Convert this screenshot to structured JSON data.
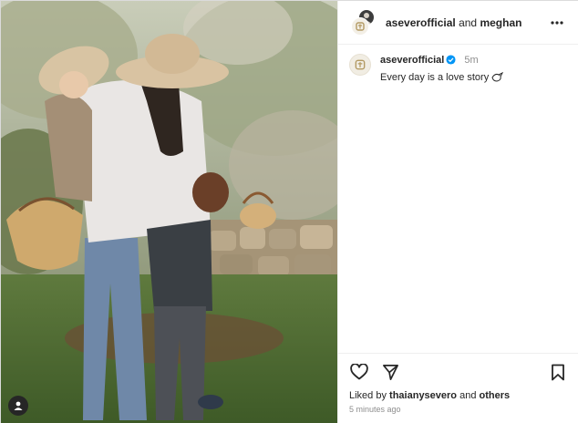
{
  "post_header": {
    "primary_user": "aseverofficial",
    "conjunction": "and",
    "secondary_user": "meghan",
    "more_icon": "more-horizontal-icon"
  },
  "caption": {
    "username": "aseverofficial",
    "verified_icon": "verified-badge-icon",
    "time_ago": "5m",
    "text": "Every day is a love story",
    "emoji_icon": "dove-icon"
  },
  "actions": {
    "like_icon": "heart-icon",
    "share_icon": "send-icon",
    "save_icon": "bookmark-icon"
  },
  "likes": {
    "prefix": "Liked by",
    "user": "thaianysevero",
    "conjunction": "and",
    "others": "others"
  },
  "timestamp": "5 minutes ago",
  "photo": {
    "tag_icon": "user-tag-icon"
  },
  "colors": {
    "text": "#262626",
    "secondary_text": "#8e8e8e",
    "verified": "#0095f6",
    "border": "#dbdbdb"
  }
}
